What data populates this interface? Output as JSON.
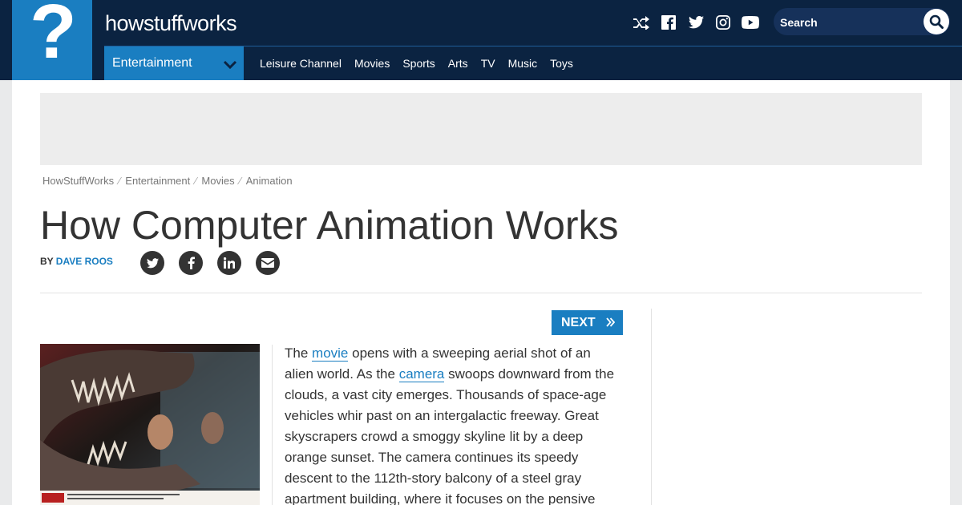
{
  "header": {
    "logo_mark": "?",
    "wordmark": "howstuffworks",
    "search_placeholder": "Search",
    "social": [
      "shuffle-icon",
      "facebook-icon",
      "twitter-icon",
      "instagram-icon",
      "youtube-icon"
    ],
    "channel": "Entertainment",
    "nav": [
      "Leisure Channel",
      "Movies",
      "Sports",
      "Arts",
      "TV",
      "Music",
      "Toys"
    ]
  },
  "breadcrumb": [
    "HowStuffWorks",
    "Entertainment",
    "Movies",
    "Animation"
  ],
  "breadcrumb_sep": "⁄",
  "article": {
    "title": "How Computer Animation Works",
    "by_label": "BY",
    "author": "DAVE ROOS",
    "next_label": "NEXT",
    "body_1": "The ",
    "link_1": "movie",
    "body_2": " opens with a sweeping aerial shot of an alien world. As the ",
    "link_2": "camera",
    "body_3": " swoops downward from the clouds, a vast city emerges. Thousands of space-age vehicles whir past on an intergalactic freeway. Great skyscrapers crowd a smoggy skyline lit by a deep orange sunset. The camera continues its speedy descent to the 112th-story balcony of a steel gray apartment building, where it focuses on the pensive"
  },
  "colors": {
    "header_bg": "#0b2341",
    "accent": "#1a7ec1"
  }
}
